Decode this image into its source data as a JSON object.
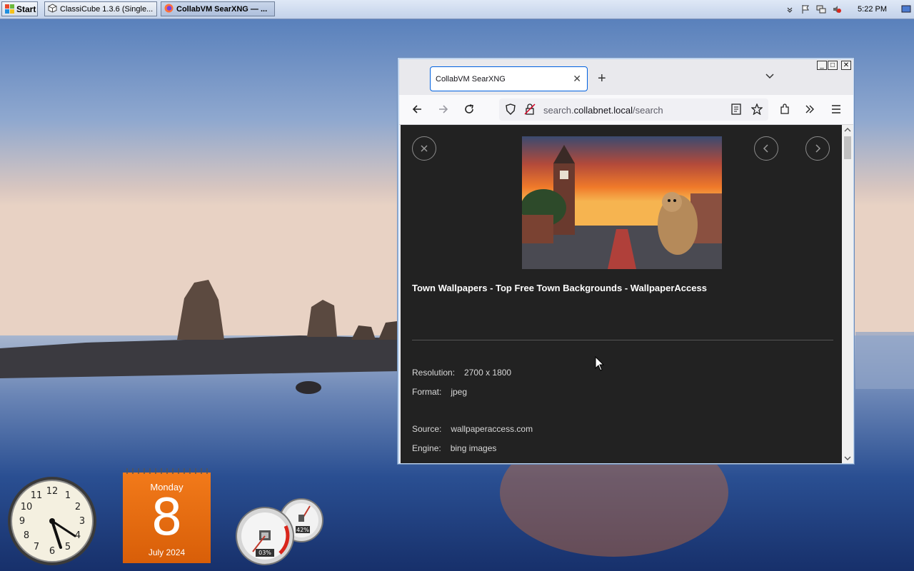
{
  "taskbar": {
    "start_label": "Start",
    "tasks": [
      {
        "label": "ClassiCube 1.3.6 (Single...",
        "icon": "cube-icon"
      },
      {
        "label": "CollabVM SearXNG — ...",
        "icon": "firefox-icon"
      }
    ],
    "clock": "5:22 PM"
  },
  "browser": {
    "tab_title": "CollabVM SearXNG",
    "url_prefix": "search.",
    "url_domain": "collabnet.local",
    "url_path": "/search",
    "window_controls": {
      "minimize": "_",
      "maximize": "□",
      "close": "✕"
    }
  },
  "result": {
    "title": "Town Wallpapers - Top Free Town Backgrounds - WallpaperAccess",
    "resolution_label": "Resolution:",
    "resolution_value": "2700 x 1800",
    "format_label": "Format:",
    "format_value": "jpeg",
    "source_label": "Source:",
    "source_value": "wallpaperaccess.com",
    "engine_label": "Engine:",
    "engine_value": "bing images"
  },
  "gadgets": {
    "calendar_weekday": "Monday",
    "calendar_day": "8",
    "calendar_month": "July 2024",
    "cpu_percent": "03%",
    "memory_percent": "42%"
  },
  "colors": {
    "accent": "#0061e0",
    "content_bg": "#222222",
    "calendar_orange": "#e8690f"
  }
}
